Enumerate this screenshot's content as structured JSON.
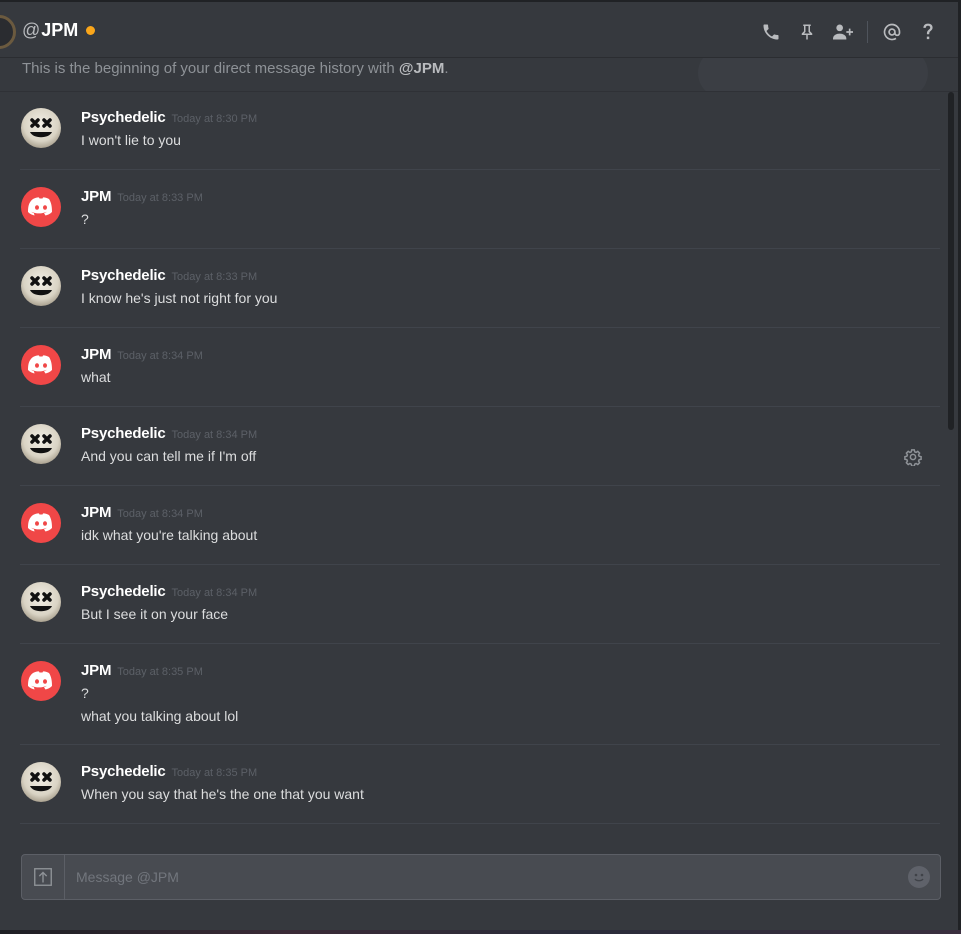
{
  "header": {
    "at_symbol": "@",
    "channel_name": "JPM",
    "status_color": "#faa61a",
    "icons": [
      "phone-icon",
      "pin-icon",
      "add-friend-icon",
      "mention-icon",
      "help-icon"
    ]
  },
  "banner": {
    "prefix": "This is the beginning of your direct message history with ",
    "mention": "@JPM",
    "suffix": "."
  },
  "messages": [
    {
      "author": "Psychedelic",
      "time": "Today at 8:30 PM",
      "lines": [
        "I won't lie to you"
      ],
      "avatar": "psychedelic-avatar"
    },
    {
      "author": "JPM",
      "time": "Today at 8:33 PM",
      "lines": [
        "?"
      ],
      "avatar": "discord-avatar"
    },
    {
      "author": "Psychedelic",
      "time": "Today at 8:33 PM",
      "lines": [
        "I know he's just not right for you"
      ],
      "avatar": "psychedelic-avatar"
    },
    {
      "author": "JPM",
      "time": "Today at 8:34 PM",
      "lines": [
        "what"
      ],
      "avatar": "discord-avatar"
    },
    {
      "author": "Psychedelic",
      "time": "Today at 8:34 PM",
      "lines": [
        "And you can tell me if I'm off"
      ],
      "avatar": "psychedelic-avatar"
    },
    {
      "author": "JPM",
      "time": "Today at 8:34 PM",
      "lines": [
        "idk what you're talking about"
      ],
      "avatar": "discord-avatar"
    },
    {
      "author": "Psychedelic",
      "time": "Today at 8:34 PM",
      "lines": [
        "But I see it on your face"
      ],
      "avatar": "psychedelic-avatar"
    },
    {
      "author": "JPM",
      "time": "Today at 8:35 PM",
      "lines": [
        "?",
        "what you talking about lol"
      ],
      "avatar": "discord-avatar"
    },
    {
      "author": "Psychedelic",
      "time": "Today at 8:35 PM",
      "lines": [
        "When you say that he's the one that you want"
      ],
      "avatar": "psychedelic-avatar"
    }
  ],
  "composer": {
    "placeholder": "Message @JPM"
  }
}
